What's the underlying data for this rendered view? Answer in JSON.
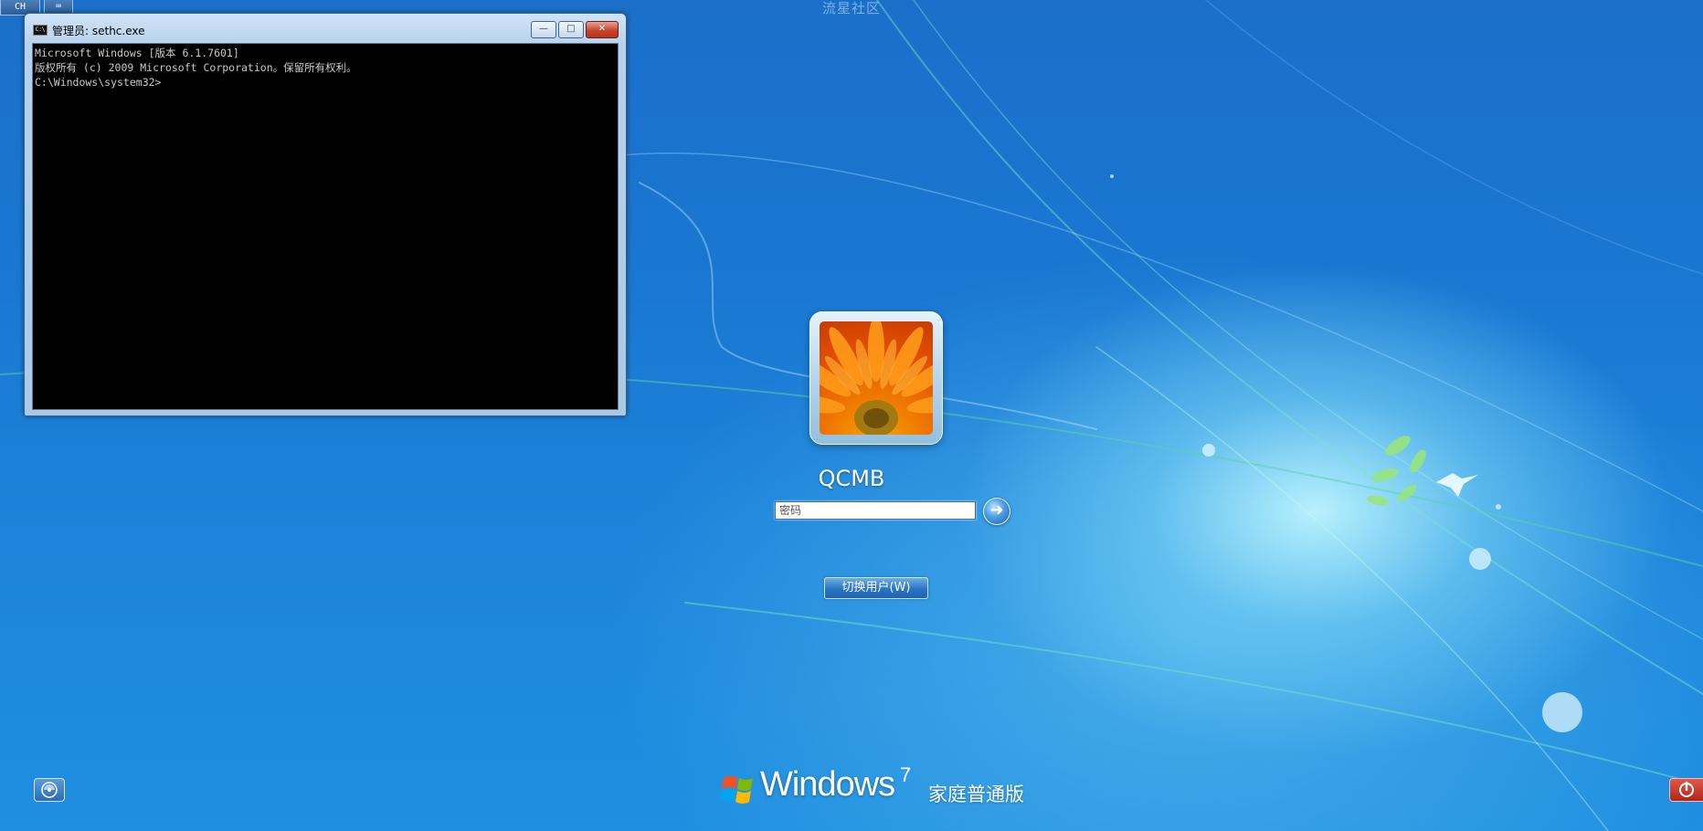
{
  "top_bar": {
    "lang_chip": "CH",
    "keyboard_chip": "⌨"
  },
  "watermark": "流星社区",
  "console": {
    "title": "管理员: sethc.exe",
    "lines": [
      "Microsoft Windows [版本 6.1.7601]",
      "版权所有 (c) 2009 Microsoft Corporation。保留所有权利。",
      "",
      "C:\\Windows\\system32>"
    ],
    "buttons": {
      "minimize": "—",
      "maximize": "□",
      "close": "✕"
    }
  },
  "login": {
    "user_name": "QCMB",
    "password_placeholder": "密码",
    "submit_glyph": "➜",
    "switch_user_label": "切换用户(W)"
  },
  "branding": {
    "windows": "Windows",
    "version": "7",
    "edition": "家庭普通版"
  },
  "colors": {
    "accent": "#1b6fc9",
    "power": "#c0392b"
  }
}
